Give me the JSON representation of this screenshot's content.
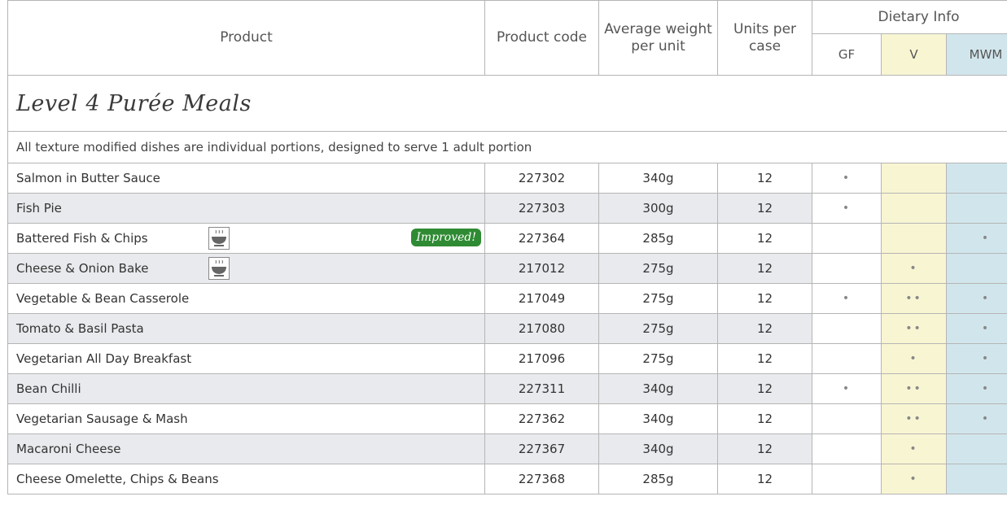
{
  "header": {
    "product": "Product",
    "product_code": "Product code",
    "average_weight": "Average weight per unit",
    "units_per_case": "Units per case",
    "dietary_info": "Dietary Info",
    "gf": "GF",
    "v": "V",
    "mwm": "MWM"
  },
  "colors": {
    "gf": "#d07a1a",
    "v": "#7a9a1f",
    "mwm": "#2e8fab",
    "improved_badge": "#2f8b33"
  },
  "section": {
    "title": "Level 4 Purée Meals",
    "note": "All texture modified dishes are individual portions, designed to serve 1 adult portion"
  },
  "badge_label": "Improved!",
  "rows": [
    {
      "name": "Salmon in Butter Sauce",
      "code": "227302",
      "weight": "340g",
      "units": "12",
      "gf": "•",
      "v": "",
      "mwm": ""
    },
    {
      "name": "Fish Pie",
      "code": "227303",
      "weight": "300g",
      "units": "12",
      "gf": "•",
      "v": "",
      "mwm": ""
    },
    {
      "name": "Battered Fish & Chips",
      "code": "227364",
      "weight": "285g",
      "units": "12",
      "gf": "",
      "v": "",
      "mwm": "•",
      "icon": "hot-bowl-icon",
      "badge": true
    },
    {
      "name": "Cheese & Onion Bake",
      "code": "217012",
      "weight": "275g",
      "units": "12",
      "gf": "",
      "v": "•",
      "mwm": "",
      "icon": "hot-bowl-icon"
    },
    {
      "name": "Vegetable & Bean Casserole",
      "code": "217049",
      "weight": "275g",
      "units": "12",
      "gf": "•",
      "v": "••",
      "mwm": "•"
    },
    {
      "name": "Tomato & Basil Pasta",
      "code": "217080",
      "weight": "275g",
      "units": "12",
      "gf": "",
      "v": "••",
      "mwm": "•"
    },
    {
      "name": "Vegetarian All Day Breakfast",
      "code": "217096",
      "weight": "275g",
      "units": "12",
      "gf": "",
      "v": "•",
      "mwm": "•"
    },
    {
      "name": "Bean Chilli",
      "code": "227311",
      "weight": "340g",
      "units": "12",
      "gf": "•",
      "v": "••",
      "mwm": "•"
    },
    {
      "name": "Vegetarian Sausage & Mash",
      "code": "227362",
      "weight": "340g",
      "units": "12",
      "gf": "",
      "v": "••",
      "mwm": "•"
    },
    {
      "name": "Macaroni Cheese",
      "code": "227367",
      "weight": "340g",
      "units": "12",
      "gf": "",
      "v": "•",
      "mwm": ""
    },
    {
      "name": "Cheese Omelette, Chips & Beans",
      "code": "227368",
      "weight": "285g",
      "units": "12",
      "gf": "",
      "v": "•",
      "mwm": ""
    }
  ]
}
